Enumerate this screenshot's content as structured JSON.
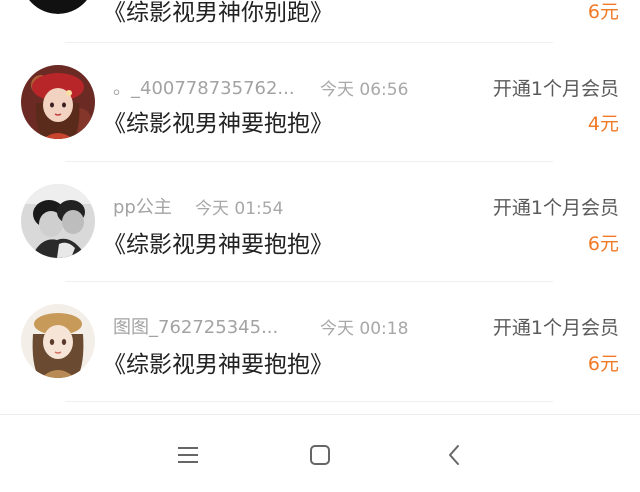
{
  "rows": [
    {
      "username": "",
      "time": "",
      "action": "",
      "title": "《综影视男神你别跑》",
      "price": "6元",
      "avatar_icon": "black-avatar-icon"
    },
    {
      "username": "。_400778735762...",
      "time": "今天 06:56",
      "action": "开通1个月会员",
      "title": "《综影视男神要抱抱》",
      "price": "4元",
      "avatar_icon": "girl-red-hat-avatar-icon"
    },
    {
      "username": "pp公主",
      "time": "今天 01:54",
      "action": "开通1个月会员",
      "title": "《综影视男神要抱抱》",
      "price": "6元",
      "avatar_icon": "couple-bw-avatar-icon"
    },
    {
      "username": "图图_762725345...",
      "time": "今天 00:18",
      "action": "开通1个月会员",
      "title": "《综影视男神要抱抱》",
      "price": "6元",
      "avatar_icon": "girl-beret-avatar-icon"
    }
  ],
  "navbar": {
    "menu_icon": "menu-icon",
    "home_icon": "home-square-icon",
    "back_icon": "back-chevron-icon"
  },
  "colors": {
    "price": "#f07a27",
    "username": "#a3a3a3",
    "title": "#222222"
  }
}
